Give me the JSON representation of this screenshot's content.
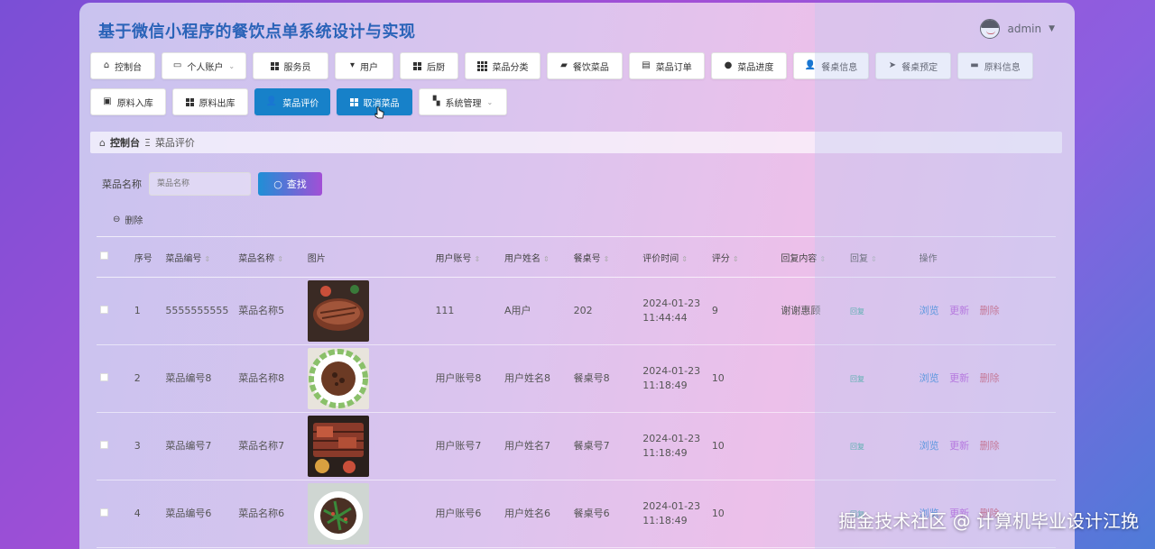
{
  "header": {
    "title": "基于微信小程序的餐饮点单系统设计与实现",
    "username": "admin"
  },
  "nav": {
    "row1": [
      {
        "label": "控制台",
        "icon": "home-icon",
        "dropdown": false,
        "active": false
      },
      {
        "label": "个人账户",
        "icon": "card-icon",
        "dropdown": true,
        "active": false
      },
      {
        "label": "服务员",
        "icon": "grid-icon",
        "dropdown": false,
        "active": false
      },
      {
        "label": "用户",
        "icon": "brush-icon",
        "dropdown": false,
        "active": false
      },
      {
        "label": "后厨",
        "icon": "grid-icon",
        "dropdown": false,
        "active": false
      },
      {
        "label": "菜品分类",
        "icon": "grid9-icon",
        "dropdown": false,
        "active": false
      },
      {
        "label": "餐饮菜品",
        "icon": "wallet-icon",
        "dropdown": false,
        "active": false
      },
      {
        "label": "菜品订单",
        "icon": "clipboard-icon",
        "dropdown": false,
        "active": false
      },
      {
        "label": "菜品进度",
        "icon": "pin-icon",
        "dropdown": false,
        "active": false
      },
      {
        "label": "餐桌信息",
        "icon": "user-icon",
        "dropdown": false,
        "active": false
      },
      {
        "label": "餐桌预定",
        "icon": "send-icon",
        "dropdown": false,
        "active": false
      },
      {
        "label": "原料信息",
        "icon": "monitor-icon",
        "dropdown": false,
        "active": false
      }
    ],
    "row2": [
      {
        "label": "原料入库",
        "icon": "briefcase-icon",
        "dropdown": false,
        "active": false
      },
      {
        "label": "原料出库",
        "icon": "grid-icon",
        "dropdown": false,
        "active": false
      },
      {
        "label": "菜品评价",
        "icon": "user-icon",
        "dropdown": false,
        "active": true
      },
      {
        "label": "取消菜品",
        "icon": "grid-icon",
        "dropdown": false,
        "active": true
      },
      {
        "label": "系统管理",
        "icon": "ticket-icon",
        "dropdown": true,
        "active": false
      }
    ]
  },
  "breadcrumb": {
    "home": "控制台",
    "separator": "Ξ",
    "current": "菜品评价"
  },
  "search": {
    "label": "菜品名称",
    "placeholder": "菜品名称",
    "button": "查找"
  },
  "toolbar": {
    "delete_label": "删除"
  },
  "table": {
    "headers": {
      "index": "序号",
      "code": "菜品编号",
      "name": "菜品名称",
      "image": "图片",
      "account": "用户账号",
      "username": "用户姓名",
      "table_no": "餐桌号",
      "time": "评价时间",
      "score": "评分",
      "reply_content": "回复内容",
      "reply": "回复",
      "ops": "操作"
    },
    "rows": [
      {
        "index": "1",
        "code": "5555555555",
        "name": "菜品名称5",
        "image": "steak",
        "account": "111",
        "username": "A用户",
        "table_no": "202",
        "time": "2024-01-23 11:44:44",
        "score": "9",
        "reply_content": "谢谢惠顾",
        "reply": "回复"
      },
      {
        "index": "2",
        "code": "菜品编号8",
        "name": "菜品名称8",
        "image": "meat-plate",
        "account": "用户账号8",
        "username": "用户姓名8",
        "table_no": "餐桌号8",
        "time": "2024-01-23 11:18:49",
        "score": "10",
        "reply_content": "",
        "reply": "回复"
      },
      {
        "index": "3",
        "code": "菜品编号7",
        "name": "菜品名称7",
        "image": "grill",
        "account": "用户账号7",
        "username": "用户姓名7",
        "table_no": "餐桌号7",
        "time": "2024-01-23 11:18:49",
        "score": "10",
        "reply_content": "",
        "reply": "回复"
      },
      {
        "index": "4",
        "code": "菜品编号6",
        "name": "菜品名称6",
        "image": "stir-fry",
        "account": "用户账号6",
        "username": "用户姓名6",
        "table_no": "餐桌号6",
        "time": "2024-01-23 11:18:49",
        "score": "10",
        "reply_content": "",
        "reply": "回复"
      }
    ],
    "ops": {
      "view": "浏览",
      "update": "更新",
      "delete": "删除"
    }
  },
  "watermark": "掘金技术社区 @ 计算机毕业设计江挽",
  "colors": {
    "accent": "#1781c9",
    "title": "#2a63b8",
    "view": "#2b7fd6",
    "update": "#b24fd6",
    "delete": "#c94f6a"
  }
}
